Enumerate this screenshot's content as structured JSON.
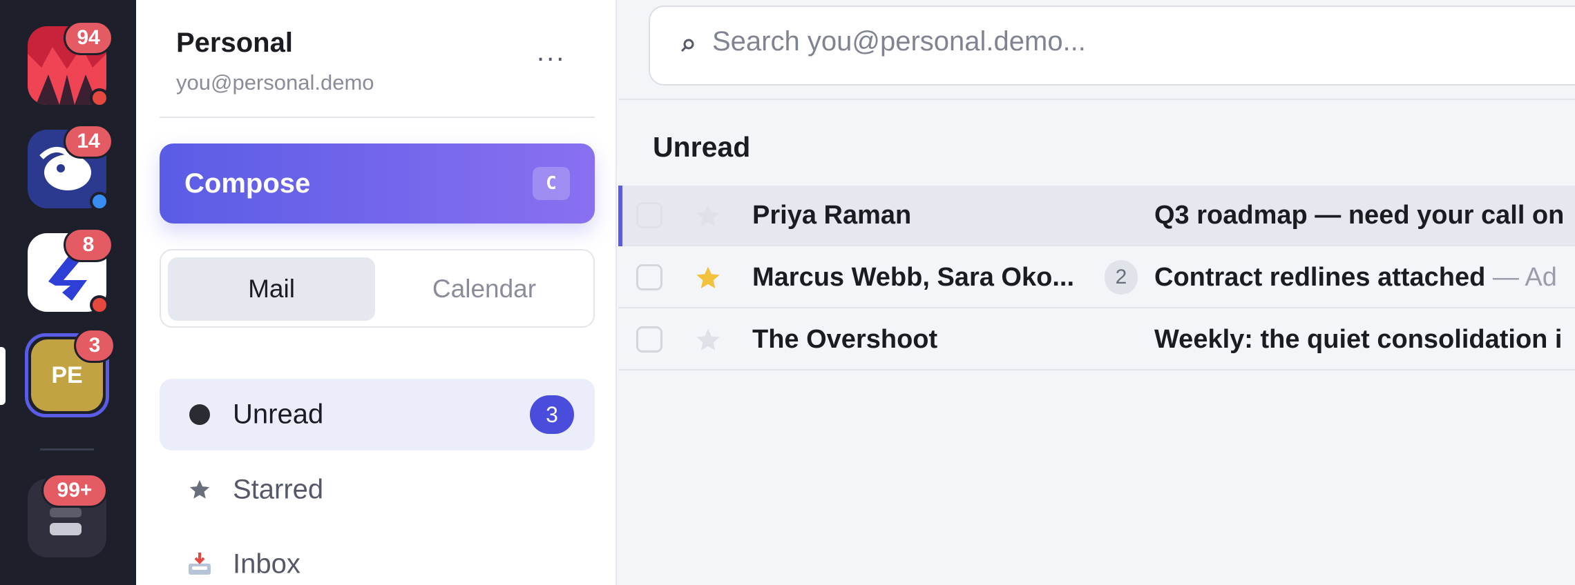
{
  "rail": {
    "accounts": [
      {
        "name": "red-account",
        "badge": "94",
        "dot_color": "#e5483f"
      },
      {
        "name": "blue-account",
        "badge": "14",
        "dot_color": "#3a8df0"
      },
      {
        "name": "white-account",
        "badge": "8",
        "dot_color": "#e5483f"
      },
      {
        "name": "personal-account",
        "initials": "PE",
        "badge": "3"
      },
      {
        "name": "dark-account",
        "badge": "99+"
      }
    ]
  },
  "sidebar": {
    "account_name": "Personal",
    "account_email": "you@personal.demo",
    "more": "...",
    "compose_label": "Compose",
    "compose_shortcut": "C",
    "segments": {
      "mail": "Mail",
      "calendar": "Calendar"
    },
    "nav": {
      "unread": {
        "label": "Unread",
        "count": "3"
      },
      "starred": {
        "label": "Starred"
      },
      "inbox": {
        "label": "Inbox"
      }
    }
  },
  "main": {
    "search_placeholder": "Search you@personal.demo...",
    "section_title": "Unread",
    "messages": [
      {
        "sender": "Priya Raman",
        "subject": "Q3 roadmap — need your call on",
        "snippet": "",
        "starred": false,
        "thread_count": ""
      },
      {
        "sender": "Marcus Webb, Sara Oko...",
        "subject": "Contract redlines attached",
        "snippet": " — Ad",
        "starred": true,
        "thread_count": "2"
      },
      {
        "sender": "The Overshoot",
        "subject": "Weekly: the quiet consolidation i",
        "snippet": "",
        "starred": false,
        "thread_count": ""
      }
    ]
  },
  "colors": {
    "accent": "#5a5ce6",
    "star_on": "#f2c23c",
    "star_off": "#d4d6de",
    "badge": "#e45b64"
  }
}
